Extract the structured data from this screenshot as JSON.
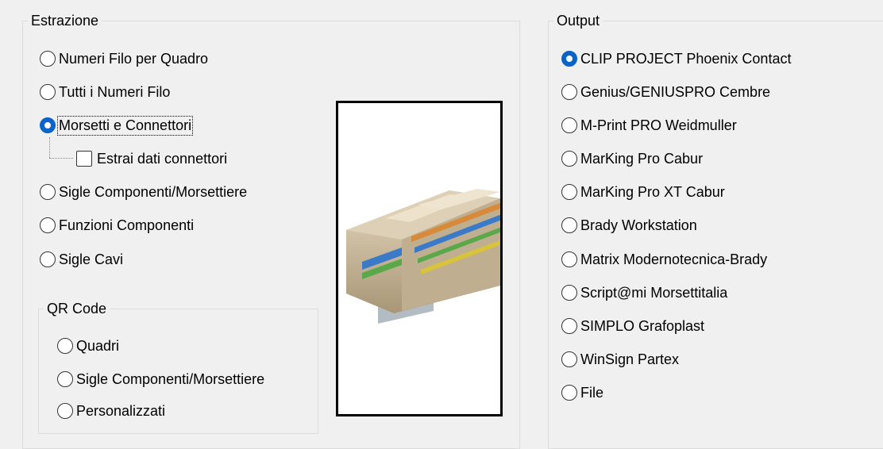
{
  "extraction": {
    "title": "Estrazione",
    "options": [
      {
        "label": "Numeri Filo per Quadro",
        "checked": false
      },
      {
        "label": "Tutti i Numeri Filo",
        "checked": false
      },
      {
        "label": "Morsetti e Connettori",
        "checked": true
      },
      {
        "label": "Sigle Componenti/Morsettiere",
        "checked": false
      },
      {
        "label": "Funzioni Componenti",
        "checked": false
      },
      {
        "label": "Sigle Cavi",
        "checked": false
      }
    ],
    "connector_checkbox": {
      "label": "Estrai dati connettori",
      "checked": false
    }
  },
  "qr": {
    "title": "QR Code",
    "options": [
      {
        "label": "Quadri",
        "checked": false
      },
      {
        "label": "Sigle Componenti/Morsettiere",
        "checked": false
      },
      {
        "label": "Personalizzati",
        "checked": false
      }
    ]
  },
  "output": {
    "title": "Output",
    "options": [
      {
        "label": "CLIP PROJECT Phoenix Contact",
        "checked": true
      },
      {
        "label": "Genius/GENIUSPRO Cembre",
        "checked": false
      },
      {
        "label": "M-Print PRO Weidmuller",
        "checked": false
      },
      {
        "label": "MarKing Pro Cabur",
        "checked": false
      },
      {
        "label": "MarKing Pro XT Cabur",
        "checked": false
      },
      {
        "label": "Brady Workstation",
        "checked": false
      },
      {
        "label": "Matrix Modernotecnica-Brady",
        "checked": false
      },
      {
        "label": "Script@mi Morsettitalia",
        "checked": false
      },
      {
        "label": "SIMPLO Grafoplast",
        "checked": false
      },
      {
        "label": "WinSign Partex",
        "checked": false
      },
      {
        "label": "File",
        "checked": false
      }
    ]
  },
  "colors": {
    "accent": "#0a64c8",
    "terminal": "#c8b89a"
  }
}
